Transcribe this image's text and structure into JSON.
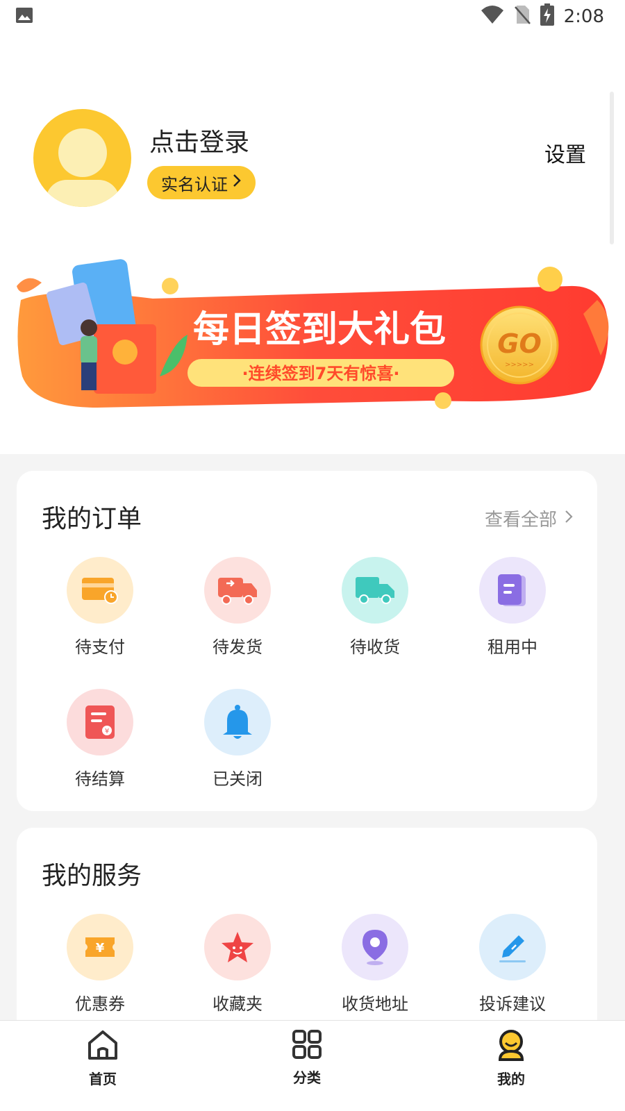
{
  "status_bar": {
    "time": "2:08"
  },
  "profile": {
    "login_text": "点击登录",
    "verify_label": "实名认证",
    "settings_label": "设置"
  },
  "banner": {
    "title": "每日签到大礼包",
    "subtitle": "·连续签到7天有惊喜·",
    "go_label": "GO",
    "go_arrows": ">>>>>"
  },
  "orders": {
    "title": "我的订单",
    "view_all": "查看全部",
    "items": [
      {
        "label": "待支付",
        "icon": "card-icon",
        "bg": "#ffeccb",
        "color": "#f9a52a"
      },
      {
        "label": "待发货",
        "icon": "truck-icon",
        "bg": "#fde1de",
        "color": "#f36a55"
      },
      {
        "label": "待收货",
        "icon": "delivery-truck-icon",
        "bg": "#c8f3ee",
        "color": "#3fc9bd"
      },
      {
        "label": "租用中",
        "icon": "document-icon",
        "bg": "#ece6fb",
        "color": "#8a6de3"
      },
      {
        "label": "待结算",
        "icon": "bill-icon",
        "bg": "#fcdcdc",
        "color": "#ef5656"
      },
      {
        "label": "已关闭",
        "icon": "bell-icon",
        "bg": "#ddeefb",
        "color": "#2597ea"
      }
    ]
  },
  "services": {
    "title": "我的服务",
    "items": [
      {
        "label": "优惠券",
        "icon": "coupon-icon",
        "bg": "#ffeccb",
        "color": "#f9a52a"
      },
      {
        "label": "收藏夹",
        "icon": "star-icon",
        "bg": "#fde1de",
        "color": "#ef4444"
      },
      {
        "label": "收货地址",
        "icon": "location-pin-icon",
        "bg": "#ece6fb",
        "color": "#8a6de3"
      },
      {
        "label": "投诉建议",
        "icon": "feedback-edit-icon",
        "bg": "#ddeefb",
        "color": "#2597ea"
      }
    ]
  },
  "bottom_nav": {
    "items": [
      {
        "label": "首页",
        "icon": "home-icon"
      },
      {
        "label": "分类",
        "icon": "grid-icon"
      },
      {
        "label": "我的",
        "icon": "profile-icon",
        "active": true
      }
    ]
  },
  "colors": {
    "accent": "#fcc830",
    "background_gray": "#f4f4f4"
  }
}
